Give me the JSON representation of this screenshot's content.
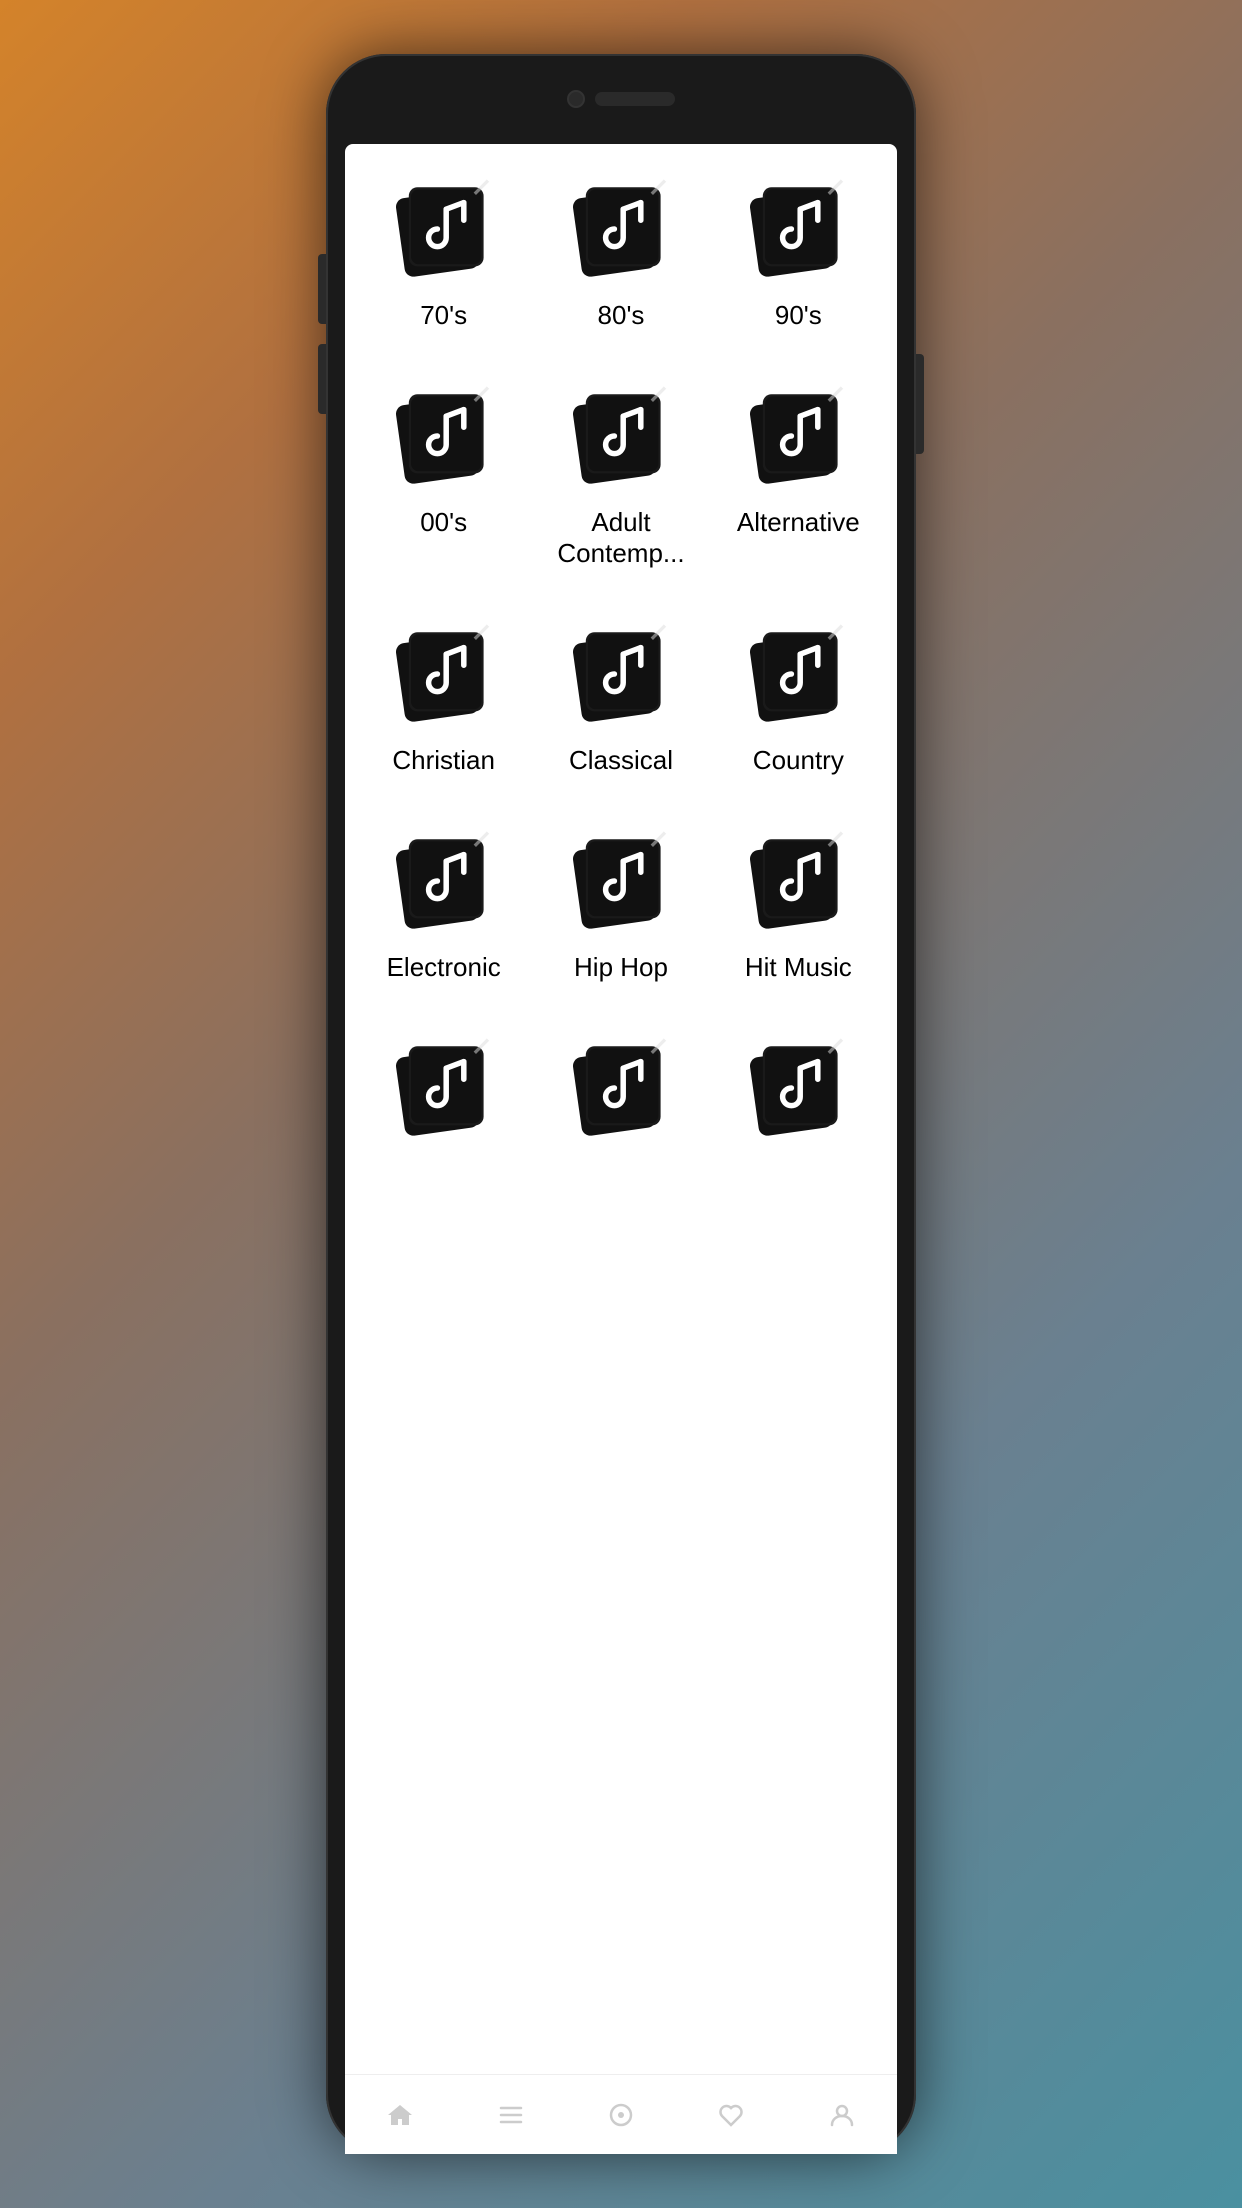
{
  "genres": [
    {
      "id": "70s",
      "label": "70's"
    },
    {
      "id": "80s",
      "label": "80's"
    },
    {
      "id": "90s",
      "label": "90's"
    },
    {
      "id": "00s",
      "label": "00's"
    },
    {
      "id": "adult-contemp",
      "label": "Adult Contemp..."
    },
    {
      "id": "alternative",
      "label": "Alternative"
    },
    {
      "id": "christian",
      "label": "Christian"
    },
    {
      "id": "classical",
      "label": "Classical"
    },
    {
      "id": "country",
      "label": "Country"
    },
    {
      "id": "electronic",
      "label": "Electronic"
    },
    {
      "id": "hip-hop",
      "label": "Hip Hop"
    },
    {
      "id": "hit-music",
      "label": "Hit Music"
    },
    {
      "id": "partial1",
      "label": ""
    },
    {
      "id": "partial2",
      "label": ""
    },
    {
      "id": "partial3",
      "label": ""
    }
  ],
  "nav": {
    "items": [
      "home",
      "browse",
      "library",
      "favorites",
      "profile"
    ]
  }
}
